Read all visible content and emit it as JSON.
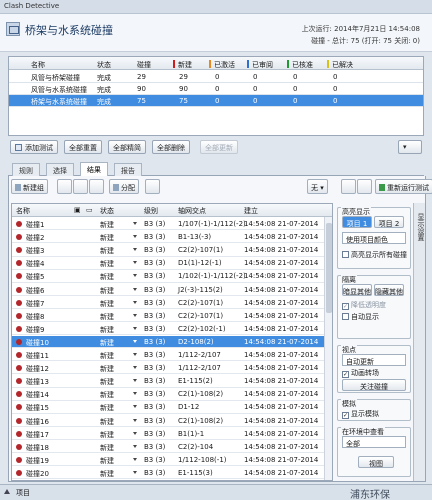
{
  "window": {
    "title": "Clash Detective"
  },
  "header": {
    "clash_name": "桥架与水系统碰撞",
    "last_run": "上次运行: 2014年7月21日 14:54:08",
    "summary": "碰撞 - 总计: 75  (打开: 75  关闭: 0)"
  },
  "tests_table": {
    "columns": [
      "名称",
      "状态",
      "碰撞",
      "新建",
      "已激活",
      "已审阅",
      "已核准",
      "已解决"
    ],
    "column_colors": [
      "",
      "",
      "",
      "#d01c1c",
      "#e7891f",
      "#2f6fd0",
      "#1e9a33",
      "#d7c21a"
    ],
    "rows": [
      [
        "风管与桥架碰撞",
        "完成",
        "29",
        "29",
        "0",
        "0",
        "0",
        "0"
      ],
      [
        "风管与水系统碰撞",
        "完成",
        "90",
        "90",
        "0",
        "0",
        "0",
        "0"
      ],
      [
        "桥架与水系统碰撞",
        "完成",
        "75",
        "75",
        "0",
        "0",
        "0",
        "0"
      ]
    ],
    "selected_row": 2
  },
  "test_buttons": {
    "add": "添加测试",
    "reset_all": "全部重置",
    "compact_all": "全部精简",
    "delete_all": "全部删除",
    "update_all": "全部更新"
  },
  "tabs": [
    "规则",
    "选择",
    "结果",
    "报告"
  ],
  "active_tab": 2,
  "results_toolbar": {
    "new_group": "新建组",
    "assign": "分配",
    "none": "无",
    "rerun": "重新运行测试"
  },
  "results_table": {
    "columns": [
      "名称",
      "状态",
      "级别",
      "轴网交点",
      "建立"
    ],
    "rows": [
      [
        "碰撞1",
        "新建",
        "B3 (3)",
        "1/107(-1)-1/112(-2)",
        "14:54:08 21-07-2014"
      ],
      [
        "碰撞2",
        "新建",
        "B3 (3)",
        "B1-13(-3)",
        "14:54:08 21-07-2014"
      ],
      [
        "碰撞3",
        "新建",
        "B3 (3)",
        "C2(2)-107(1)",
        "14:54:08 21-07-2014"
      ],
      [
        "碰撞4",
        "新建",
        "B3 (3)",
        "D1(1)-12(-1)",
        "14:54:08 21-07-2014"
      ],
      [
        "碰撞5",
        "新建",
        "B3 (3)",
        "1/102(-1)-1/112(-2)",
        "14:54:08 21-07-2014"
      ],
      [
        "碰撞6",
        "新建",
        "B3 (3)",
        "J2(-3)-115(2)",
        "14:54:08 21-07-2014"
      ],
      [
        "碰撞7",
        "新建",
        "B3 (3)",
        "C2(2)-107(1)",
        "14:54:08 21-07-2014"
      ],
      [
        "碰撞8",
        "新建",
        "B3 (3)",
        "C2(2)-107(1)",
        "14:54:08 21-07-2014"
      ],
      [
        "碰撞9",
        "新建",
        "B3 (3)",
        "C2(2)-102(-1)",
        "14:54:08 21-07-2014"
      ],
      [
        "碰撞10",
        "新建",
        "B3 (3)",
        "D2-108(2)",
        "14:54:08 21-07-2014"
      ],
      [
        "碰撞11",
        "新建",
        "B3 (3)",
        "1/112-2/107",
        "14:54:08 21-07-2014"
      ],
      [
        "碰撞12",
        "新建",
        "B3 (3)",
        "1/112-2/107",
        "14:54:08 21-07-2014"
      ],
      [
        "碰撞13",
        "新建",
        "B3 (3)",
        "E1-115(2)",
        "14:54:08 21-07-2014"
      ],
      [
        "碰撞14",
        "新建",
        "B3 (3)",
        "C2(1)-108(2)",
        "14:54:08 21-07-2014"
      ],
      [
        "碰撞15",
        "新建",
        "B3 (3)",
        "D1-12",
        "14:54:08 21-07-2014"
      ],
      [
        "碰撞16",
        "新建",
        "B3 (3)",
        "C2(1)-108(2)",
        "14:54:08 21-07-2014"
      ],
      [
        "碰撞17",
        "新建",
        "B3 (3)",
        "B1(1)-1",
        "14:54:08 21-07-2014"
      ],
      [
        "碰撞18",
        "新建",
        "B3 (3)",
        "C2(2)-104",
        "14:54:08 21-07-2014"
      ],
      [
        "碰撞19",
        "新建",
        "B3 (3)",
        "1/112-108(-1)",
        "14:54:08 21-07-2014"
      ],
      [
        "碰撞20",
        "新建",
        "B3 (3)",
        "E1-115(3)",
        "14:54:08 21-07-2014"
      ]
    ],
    "selected_row": 9
  },
  "side_panel": {
    "highlight_caption": "高亮显示",
    "item1": "项目 1",
    "item2": "项目 2",
    "use_item_color": "使用项目颜色",
    "highlight_all": "高亮显示所有碰撞",
    "isolate_caption": "隔离",
    "dim_others": "暗显其他",
    "hide_others": "隐藏其他",
    "reduce_transparency": "降低透明度",
    "auto_show": "自动显示",
    "viewpoint_caption": "视点",
    "auto_update": "自动更新",
    "animate": "动画转场",
    "focus_clash": "关注碰撞",
    "simulation_caption": "模拟",
    "show_simulation": "显示模拟",
    "in_context_caption": "在环境中查看",
    "all": "全部",
    "view": "视图",
    "rail_label": "显示设置"
  },
  "bottom": {
    "label": "项目"
  },
  "watermark": "浦东环保"
}
